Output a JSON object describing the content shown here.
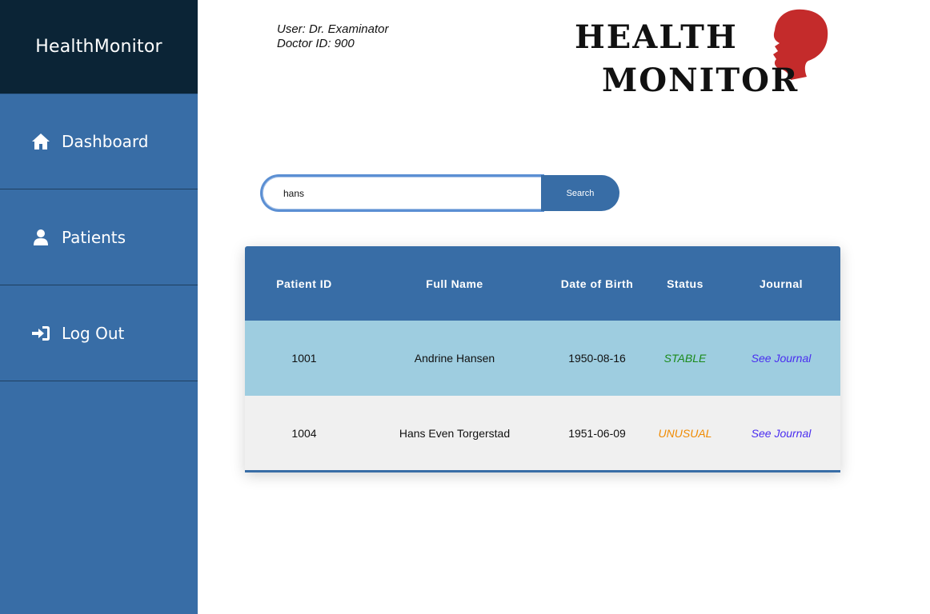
{
  "sidebar": {
    "brand": "HealthMonitor",
    "items": [
      {
        "label": "Dashboard",
        "icon": "home-icon"
      },
      {
        "label": "Patients",
        "icon": "user-icon"
      },
      {
        "label": "Log Out",
        "icon": "sign-in-icon"
      }
    ]
  },
  "header": {
    "user_line": "User: Dr. Examinator",
    "doctor_line": "Doctor ID: 900",
    "logo_line1": "HEALTH",
    "logo_line2": "MONITOR"
  },
  "search": {
    "value": "hans",
    "button_label": "Search"
  },
  "table": {
    "columns": [
      "Patient ID",
      "Full Name",
      "Date of Birth",
      "Status",
      "Journal"
    ],
    "rows": [
      {
        "id": "1001",
        "name": "Andrine Hansen",
        "dob": "1950-08-16",
        "status": "STABLE",
        "status_color": "#1b8a1b",
        "journal": "See Journal"
      },
      {
        "id": "1004",
        "name": "Hans Even Torgerstad",
        "dob": "1951-06-09",
        "status": "UNUSUAL",
        "status_color": "#f08a00",
        "journal": "See Journal"
      }
    ]
  },
  "colors": {
    "sidebar": "#386da6",
    "brand_bg": "#0b2436",
    "row_highlight": "#9ecde0",
    "row_alt": "#f0f0f0",
    "link": "#4a2df0",
    "logo_red": "#c42b2b"
  }
}
